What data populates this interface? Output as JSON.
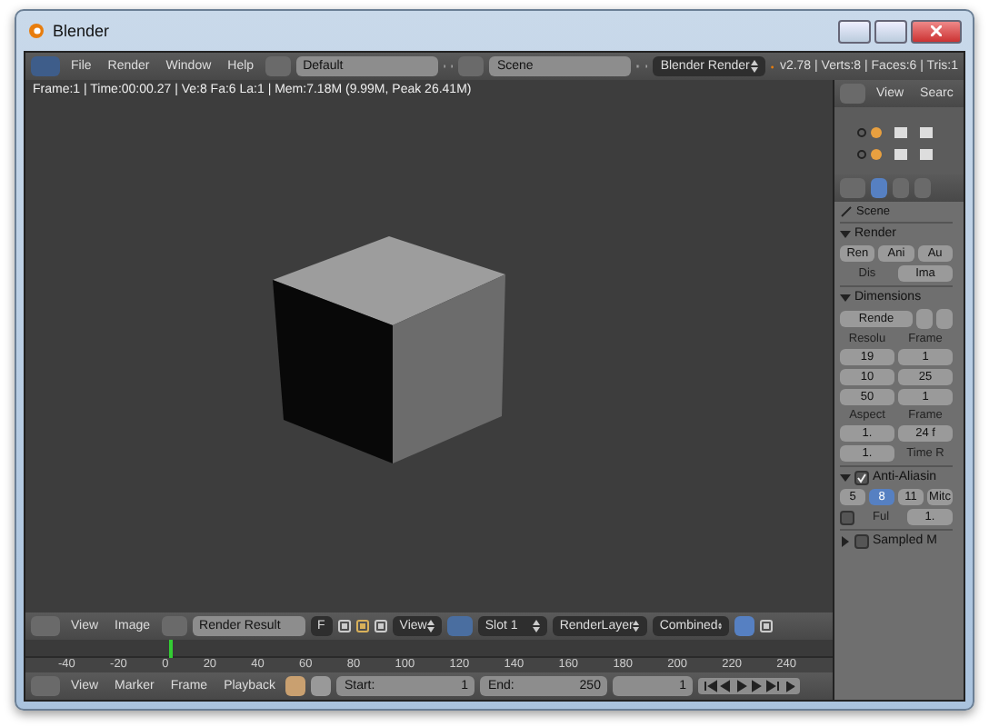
{
  "window": {
    "title": "Blender"
  },
  "info_header": {
    "menus": [
      "File",
      "Render",
      "Window",
      "Help"
    ],
    "screen": "Default",
    "scene": "Scene",
    "engine": "Blender Render",
    "stats": "v2.78 | Verts:8 | Faces:6 | Tris:1"
  },
  "viewport": {
    "info": "Frame:1 | Time:00:00.27 | Ve:8 Fa:6 La:1 | Mem:7.18M (9.99M, Peak 26.41M)"
  },
  "outliner": {
    "menus": [
      "View",
      "Searc"
    ]
  },
  "properties": {
    "context": "Scene",
    "panels": [
      {
        "kind": "render",
        "title": "Render",
        "expanded": true,
        "buttons": [
          "Ren",
          "Ani",
          "Au"
        ],
        "display_label": "Dis",
        "display_value": "Ima"
      },
      {
        "kind": "dimensions",
        "title": "Dimensions",
        "expanded": true,
        "preset": "Rende",
        "col1_label": "Resolu",
        "col2_label": "Frame",
        "col1": [
          "19",
          "10",
          "50"
        ],
        "col2": [
          "1",
          "25",
          "1"
        ],
        "aspect_label": "Aspect",
        "frame_rate_label": "Frame",
        "aspect": [
          "1.",
          "1."
        ],
        "frame_rate": "24 f",
        "time_label": "Time R"
      },
      {
        "kind": "antialiasing",
        "title": "Anti-Aliasin",
        "expanded": true,
        "checked": true,
        "samples": [
          {
            "label": "5",
            "selected": false
          },
          {
            "label": "8",
            "selected": true
          },
          {
            "label": "11",
            "selected": false
          }
        ],
        "filter": "Mitc",
        "full_label": "Ful",
        "full_checked": false,
        "size": "1."
      },
      {
        "kind": "motion",
        "title": "Sampled M",
        "expanded": false,
        "checked": false
      }
    ]
  },
  "image_editor": {
    "menus": [
      "View",
      "Image"
    ],
    "image": "Render Result",
    "fake_user": "F",
    "view": "View",
    "slot": "Slot 1",
    "layer": "RenderLayer",
    "pass": "Combined"
  },
  "timeline": {
    "ticks": [
      "-40",
      "-20",
      "0",
      "20",
      "40",
      "60",
      "80",
      "100",
      "120",
      "140",
      "160",
      "180",
      "200",
      "220",
      "240"
    ],
    "menus": [
      "View",
      "Marker",
      "Frame",
      "Playback"
    ],
    "start_label": "Start:",
    "start": "1",
    "end_label": "End:",
    "end": "250",
    "current": "1"
  }
}
